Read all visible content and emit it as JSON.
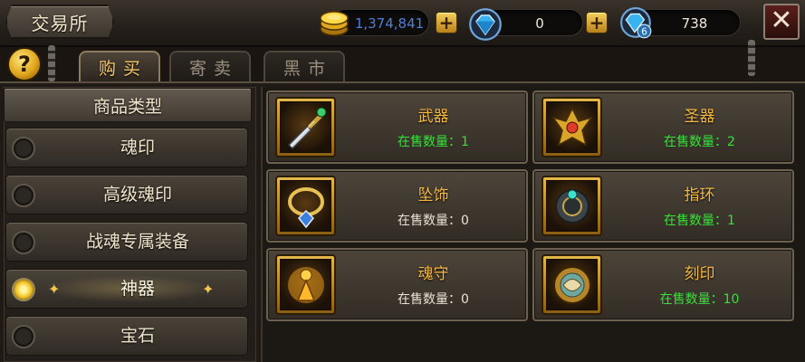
{
  "window": {
    "title": "交易所"
  },
  "currencies": {
    "gold": {
      "value": "1,374,841",
      "icon": "gold-coin-icon",
      "color": "#3f6fc4"
    },
    "diamond": {
      "value": "0",
      "icon": "diamond-icon"
    },
    "bound_diamond": {
      "value": "738",
      "icon": "bound-diamond-icon",
      "badge": "6"
    }
  },
  "buttons": {
    "plus": "+",
    "close": "✕",
    "help": "?"
  },
  "tabs": [
    {
      "label": "购买",
      "active": true
    },
    {
      "label": "寄卖",
      "active": false
    },
    {
      "label": "黑市",
      "active": false
    }
  ],
  "sidebar": {
    "header": "商品类型",
    "items": [
      {
        "label": "魂印",
        "selected": false
      },
      {
        "label": "高级魂印",
        "selected": false
      },
      {
        "label": "战魂专属装备",
        "selected": false
      },
      {
        "label": "神器",
        "selected": true
      },
      {
        "label": "宝石",
        "selected": false
      }
    ]
  },
  "items": [
    {
      "name": "武器",
      "count": "在售数量：1",
      "status": "green",
      "icon": "sword-icon"
    },
    {
      "name": "圣器",
      "count": "在售数量：2",
      "status": "green",
      "icon": "holy-relic-icon"
    },
    {
      "name": "坠饰",
      "count": "在售数量：0",
      "status": "white",
      "icon": "pendant-icon"
    },
    {
      "name": "指环",
      "count": "在售数量：1",
      "status": "green",
      "icon": "ring-icon"
    },
    {
      "name": "魂守",
      "count": "在售数量：0",
      "status": "white",
      "icon": "soul-guardian-icon"
    },
    {
      "name": "刻印",
      "count": "在售数量：10",
      "status": "green",
      "icon": "engraving-icon"
    }
  ],
  "colors": {
    "accent": "#f5b742",
    "available": "#37e03a",
    "empty": "#e9e2d4"
  }
}
